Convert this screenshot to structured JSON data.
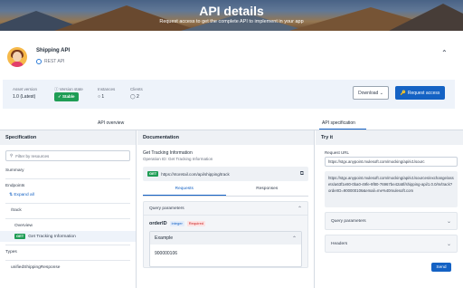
{
  "banner": {
    "title": "API details",
    "subtitle": "Request access to get the complete API to implement in your app"
  },
  "asset": {
    "name": "Shipping API",
    "type": "REST API"
  },
  "meta": {
    "asset_version_label": "Asset version",
    "asset_version_value": "1.0 (Latest)",
    "version_state_label": "Version state",
    "version_state_value": "Stable",
    "instances_label": "Instances",
    "instances_value": "1",
    "clients_label": "Clients",
    "clients_value": "2"
  },
  "actions": {
    "download": "Download",
    "request_access": "Request access"
  },
  "tabs": {
    "overview": "API overview",
    "specification": "API specification"
  },
  "specification": {
    "heading": "Specification",
    "filter_placeholder": "Filter by resources",
    "summary": "Summary",
    "endpoints": "Endpoints",
    "expand_all": "Expand all",
    "track": "/track",
    "overview": "Overview",
    "get_method": "GET",
    "get_tracking": "Get Tracking Information",
    "types": "Types",
    "type_item": "unifiedShippingResponse"
  },
  "documentation": {
    "heading": "Documentation",
    "title": "Get Tracking Information",
    "subtitle": "Operation ID: Get Tracking Information",
    "method": "GET",
    "url": "https://ntoretail.com/api/shipping/track",
    "tab_requests": "Requests",
    "tab_responses": "Responses",
    "query_params": "Query parameters",
    "param_name": "orderID",
    "param_type": "integer",
    "param_required": "Required",
    "example_label": "Example",
    "example_value": "900000106"
  },
  "try_it": {
    "heading": "Try it",
    "request_url_label": "Request URL",
    "request_url_value": "https://stgx.anypoint.mulesoft.com/mocking/api/v1/sourc",
    "full_url": "https://stgx.anypoint.mulesoft.com/mocking/api/v1/sources/exchange/assets/a63f1e80-0ba0-49fe-9f80-76967be42a5f/shipping-api/1.0.0/m/track?orderID=900000106&email=me%40mulesoft.com",
    "query_params": "Query parameters",
    "headers": "Headers",
    "send": "Send"
  },
  "colors": {
    "accent": "#1462c4",
    "stable": "#1f9d55",
    "get_badge": "#1f9d55"
  }
}
